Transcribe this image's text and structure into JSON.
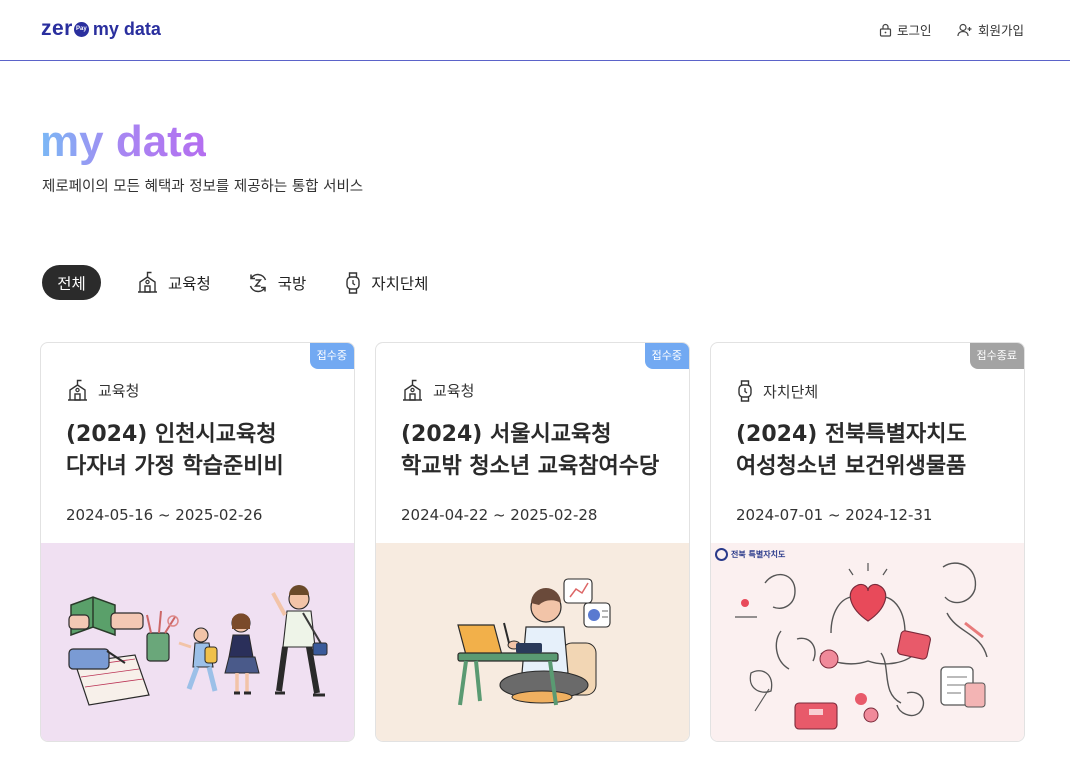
{
  "header": {
    "logo_zero": "zer",
    "logo_badge": "Pay",
    "logo_mydata": "my data",
    "login_label": "로그인",
    "signup_label": "회원가입"
  },
  "hero": {
    "title": "my data",
    "subtitle": "제로페이의 모든 혜택과 정보를 제공하는 통합 서비스"
  },
  "filters": {
    "all": "전체",
    "education": "교육청",
    "defense": "국방",
    "local": "자치단체"
  },
  "cards": [
    {
      "status": "접수중",
      "category": "교육청",
      "title_line1": "(2024) 인천시교육청",
      "title_line2": "다자녀 가정 학습준비비",
      "date": "2024-05-16 ~ 2025-02-26"
    },
    {
      "status": "접수중",
      "category": "교육청",
      "title_line1": "(2024) 서울시교육청",
      "title_line2": "학교밖 청소년 교육참여수당",
      "date": "2024-04-22 ~ 2025-02-28"
    },
    {
      "status": "접수종료",
      "category": "자치단체",
      "title_line1": "(2024) 전북특별자치도",
      "title_line2": "여성청소년 보건위생물품",
      "date": "2024-07-01 ~ 2024-12-31",
      "image_seal": "전북 특별자치도"
    }
  ],
  "colors": {
    "brand": "#2a2f9e",
    "status_open": "#72a9f2",
    "status_closed": "#a3a3a3",
    "chip_active": "#2b2b2b"
  }
}
